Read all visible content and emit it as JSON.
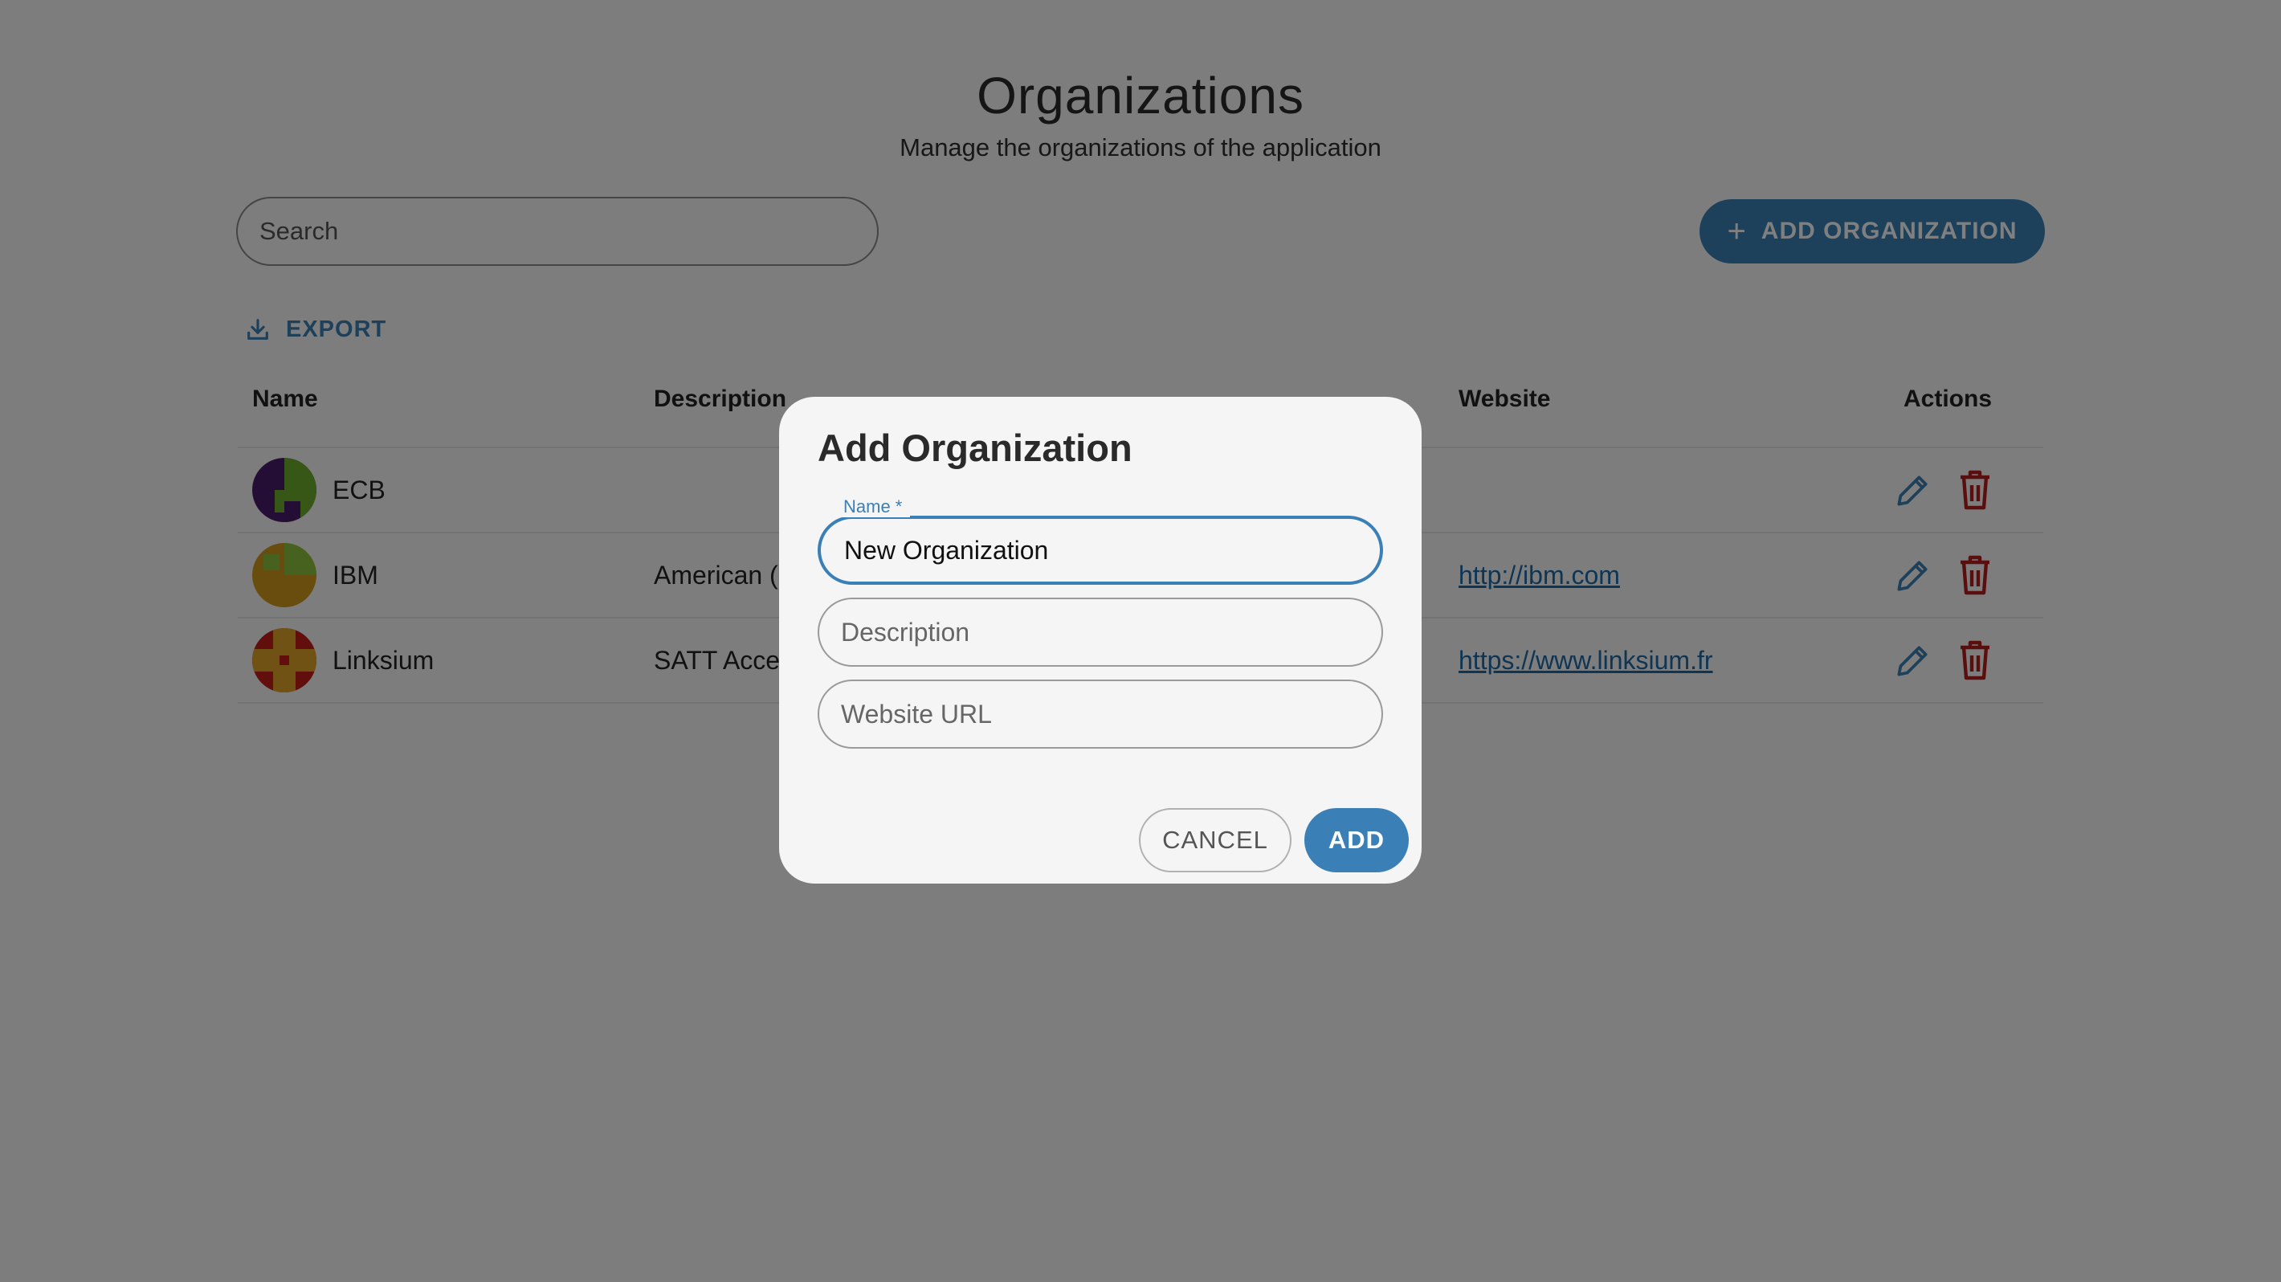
{
  "header": {
    "title": "Organizations",
    "subtitle": "Manage the organizations of the application"
  },
  "toolbar": {
    "search_placeholder": "Search",
    "add_label": "ADD ORGANIZATION",
    "export_label": "EXPORT"
  },
  "table": {
    "columns": [
      "Name",
      "Description",
      "Website",
      "Actions"
    ],
    "rows": [
      {
        "name": "ECB",
        "description": "",
        "website": ""
      },
      {
        "name": "IBM",
        "description": "American (",
        "website": "http://ibm.com"
      },
      {
        "name": "Linksium",
        "description": "SATT Acce",
        "website": "https://www.linksium.fr"
      }
    ]
  },
  "dialog": {
    "title": "Add Organization",
    "name_label": "Name *",
    "name_value": "New Organization",
    "description_placeholder": "Description",
    "website_placeholder": "Website URL",
    "cancel_label": "CANCEL",
    "add_label": "ADD"
  },
  "colors": {
    "accent": "#3a80b7",
    "delete": "#b71c1c",
    "overlay": "rgba(0,0,0,0.5)"
  }
}
